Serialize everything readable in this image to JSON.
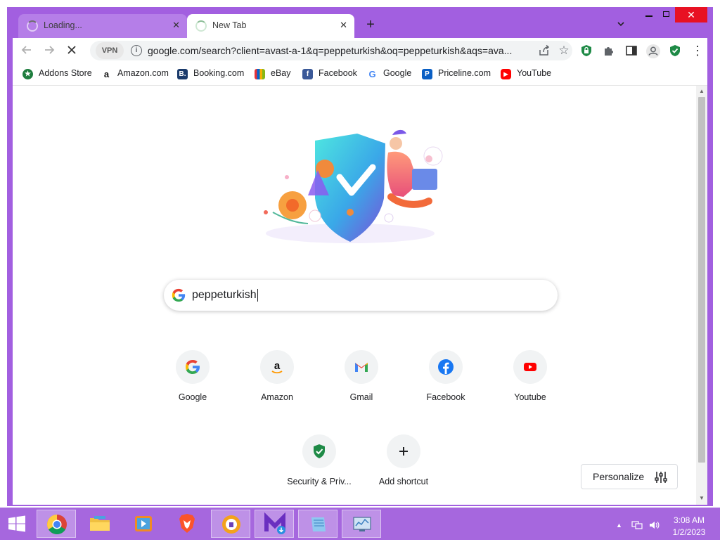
{
  "tabs": [
    {
      "title": "Loading...",
      "state": "loading"
    },
    {
      "title": "New Tab",
      "state": "active"
    }
  ],
  "toolbar": {
    "vpn_label": "VPN",
    "url": "google.com/search?client=avast-a-1&q=peppeturkish&oq=peppeturkish&aqs=ava..."
  },
  "bookmarks": [
    {
      "label": "Addons Store",
      "icon": "addons-store-icon",
      "color": "#1e7d3e"
    },
    {
      "label": "Amazon.com",
      "icon": "amazon-icon",
      "color": "#111111"
    },
    {
      "label": "Booking.com",
      "icon": "booking-icon",
      "color": "#1a3a6b"
    },
    {
      "label": "eBay",
      "icon": "ebay-icon",
      "color": "#e53238"
    },
    {
      "label": "Facebook",
      "icon": "facebook-icon",
      "color": "#3b5998"
    },
    {
      "label": "Google",
      "icon": "google-icon",
      "color": "#4285f4"
    },
    {
      "label": "Priceline.com",
      "icon": "priceline-icon",
      "color": "#0a5fc4"
    },
    {
      "label": "YouTube",
      "icon": "youtube-icon",
      "color": "#ff0000"
    }
  ],
  "search": {
    "query": "peppeturkish"
  },
  "shortcuts": [
    {
      "label": "Google",
      "icon": "google-icon"
    },
    {
      "label": "Amazon",
      "icon": "amazon-icon"
    },
    {
      "label": "Gmail",
      "icon": "gmail-icon"
    },
    {
      "label": "Facebook",
      "icon": "facebook-icon"
    },
    {
      "label": "Youtube",
      "icon": "youtube-icon"
    },
    {
      "label": "Security & Priv...",
      "icon": "security-shield-icon"
    },
    {
      "label": "Add shortcut",
      "icon": "plus-icon"
    }
  ],
  "personalize": {
    "label": "Personalize"
  },
  "taskbar": {
    "apps": [
      "chrome",
      "file-explorer",
      "media-player",
      "brave",
      "avast-secure-browser",
      "installer",
      "notepad",
      "control-panel"
    ],
    "time": "3:08 AM",
    "date": "1/2/2023"
  },
  "colors": {
    "window_frame": "#a25fe0",
    "taskbar": "#a667de",
    "close_button": "#e81123"
  }
}
